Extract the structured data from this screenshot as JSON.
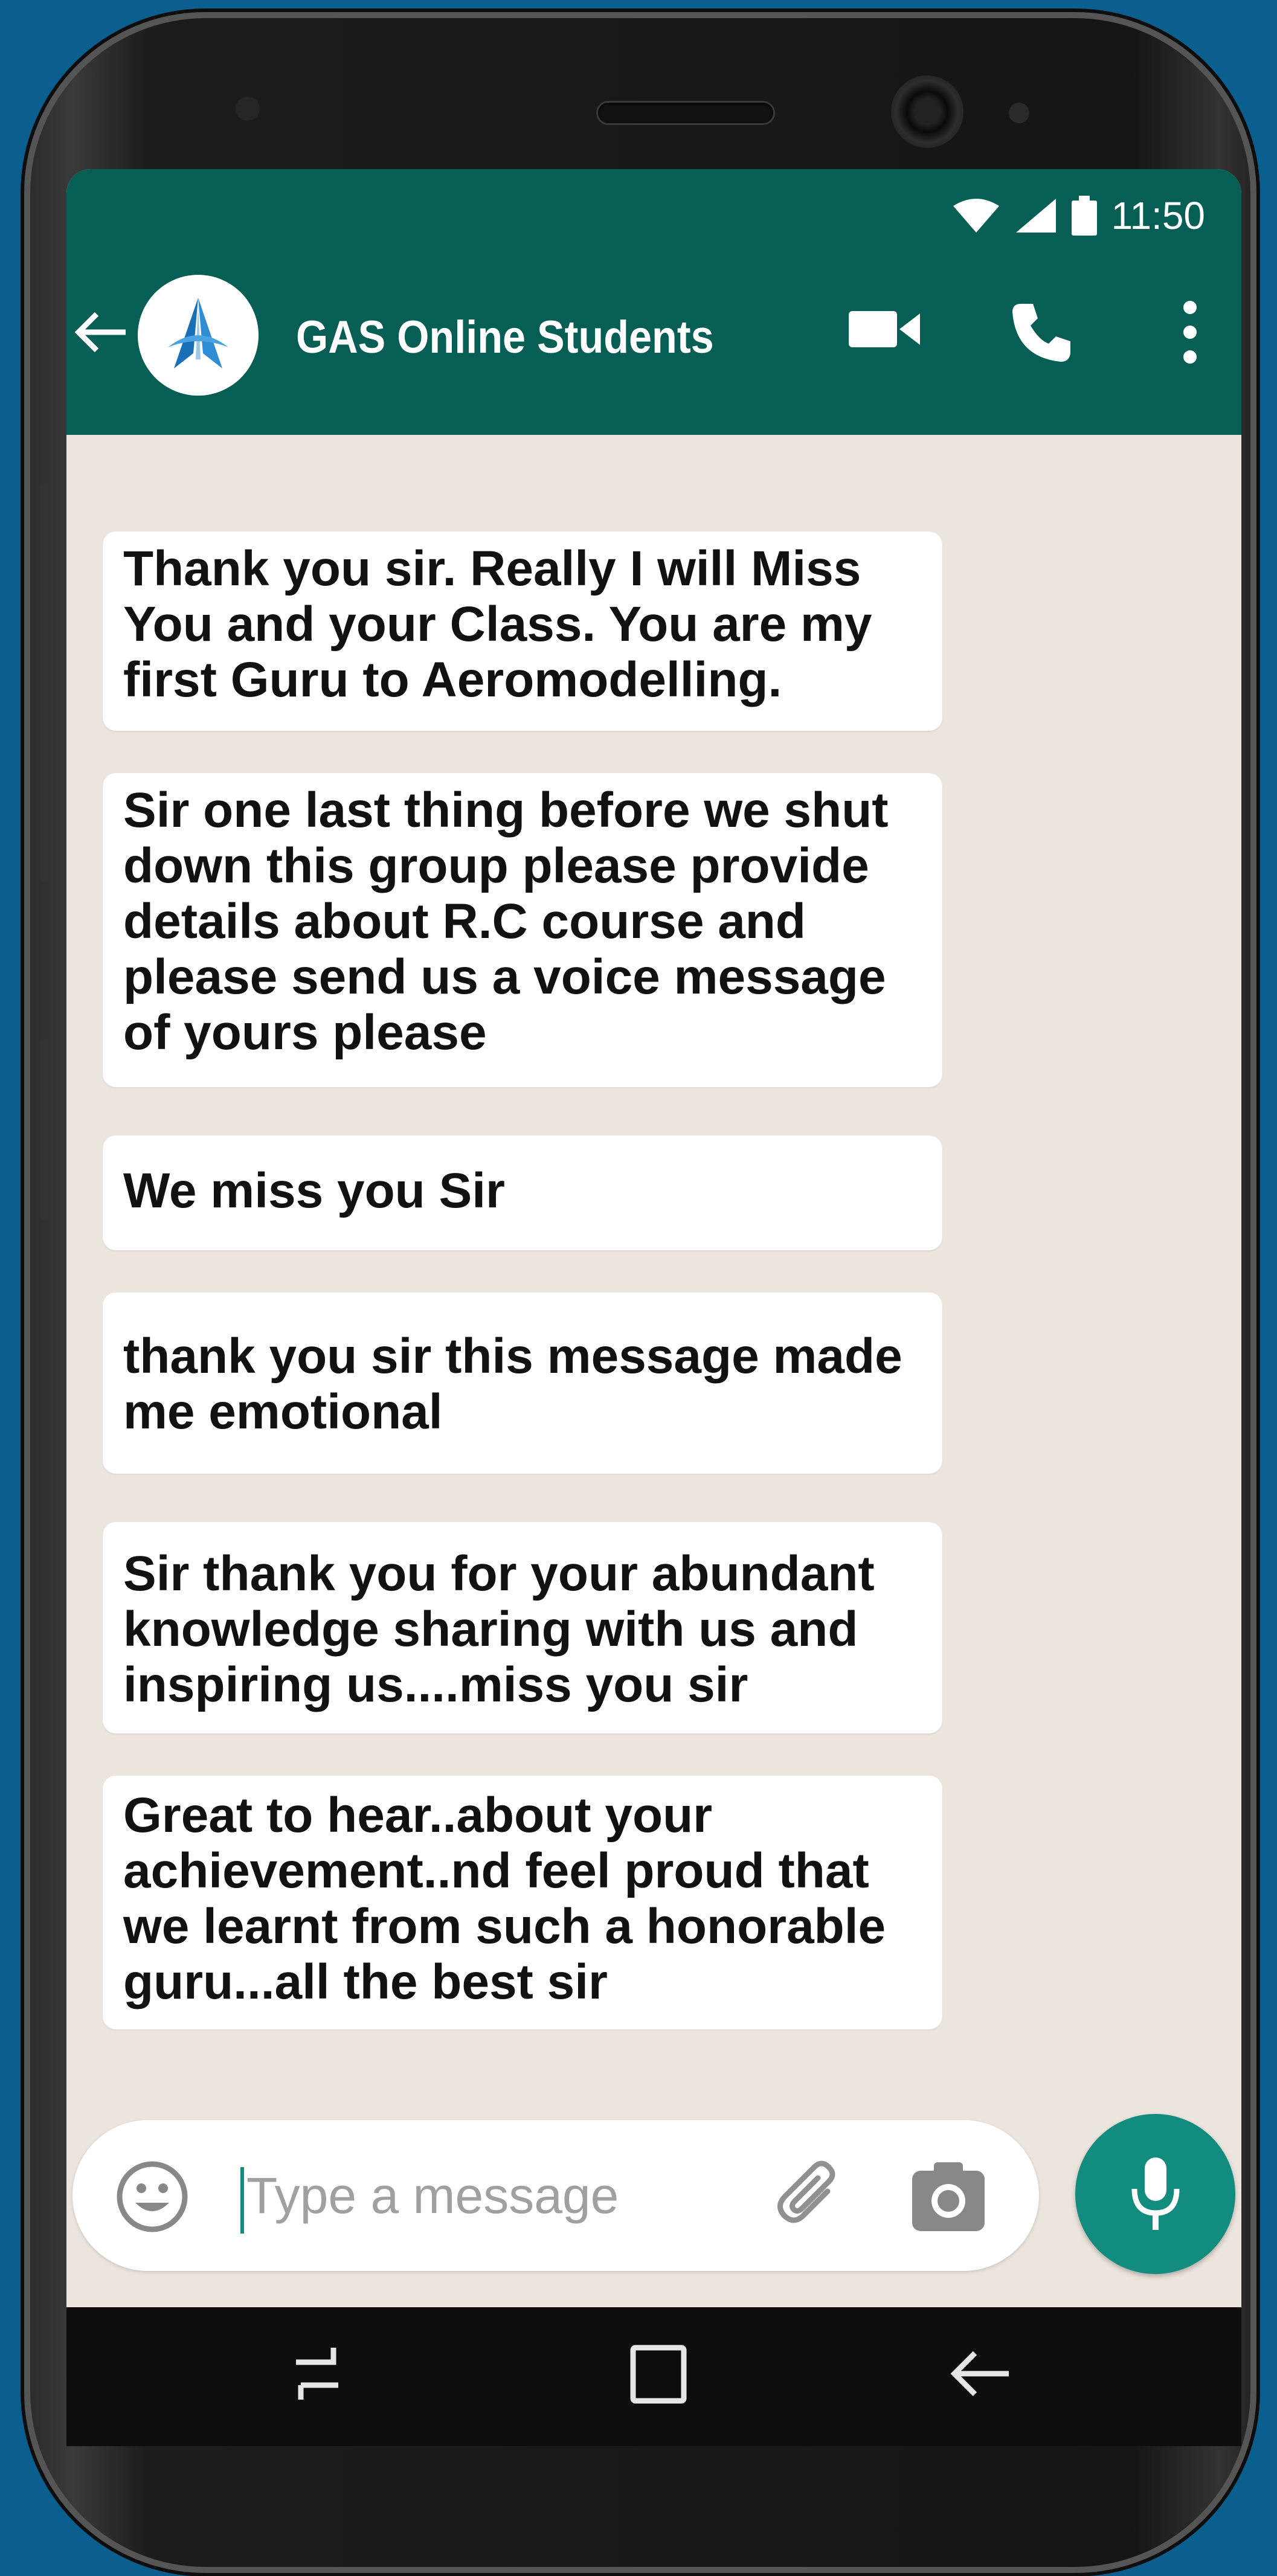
{
  "status_bar": {
    "time": "11:50"
  },
  "header": {
    "group_name": "GAS Online Students"
  },
  "messages": [
    "Thank you sir. Really I will Miss You and your Class. You are my first Guru to Aeromodelling.",
    "Sir one last thing before we shut down this group please provide details about R.C course and please send us a voice message of yours please",
    "We miss you Sir",
    "thank you sir this message made me emotional",
    "Sir thank you for your abundant knowledge sharing with us and inspiring us....miss you sir",
    "Great to hear..about your achievement..nd feel proud  that we learnt from such a honorable guru...all the best sir"
  ],
  "composer": {
    "placeholder": "Type a message"
  },
  "colors": {
    "header": "#075e54",
    "accent": "#128c7e",
    "chat_bg": "#ece5dd"
  }
}
